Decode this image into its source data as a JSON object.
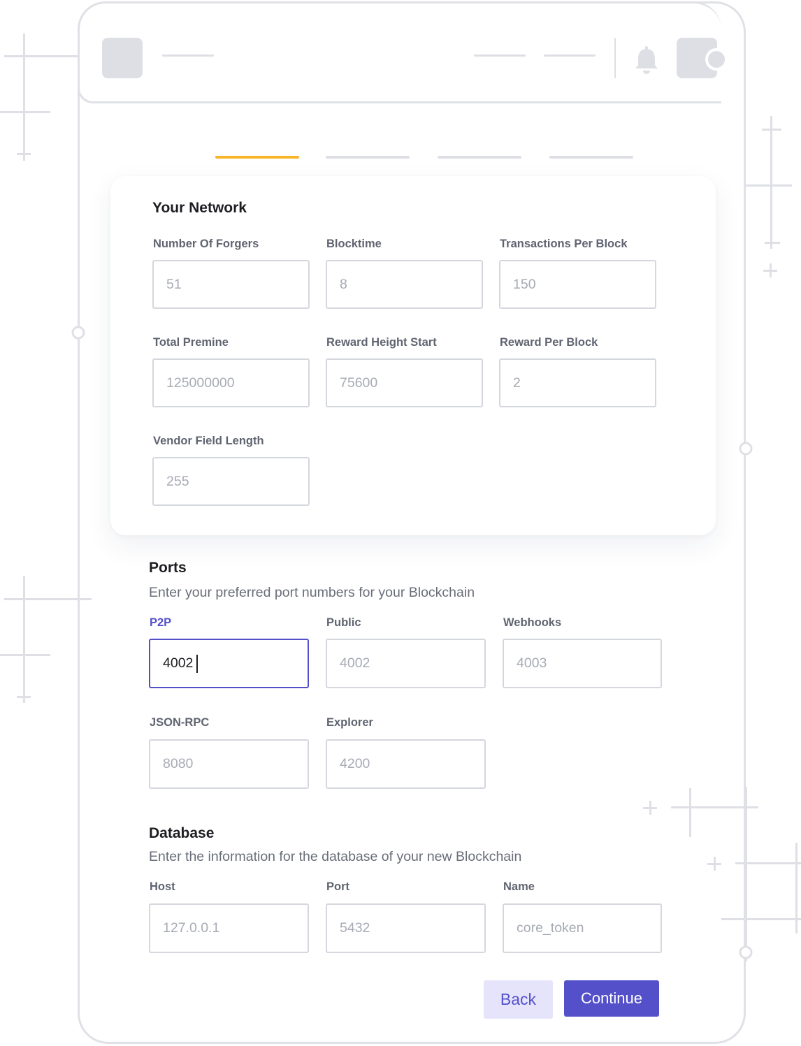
{
  "colors": {
    "accent": "#5450c9",
    "accent_soft": "#e5e4fb",
    "step_active": "#f7b52a",
    "placeholder_ui": "#dedfe5"
  },
  "header": {
    "notification_icon": "bell-icon"
  },
  "stepper": {
    "total_steps": 4,
    "active_step": 1
  },
  "network": {
    "title": "Your Network",
    "fields": [
      {
        "label": "Number Of Forgers",
        "placeholder": "51"
      },
      {
        "label": "Blocktime",
        "placeholder": "8"
      },
      {
        "label": "Transactions Per Block",
        "placeholder": "150"
      },
      {
        "label": "Total Premine",
        "placeholder": "125000000"
      },
      {
        "label": "Reward Height Start",
        "placeholder": "75600"
      },
      {
        "label": "Reward Per Block",
        "placeholder": "2"
      },
      {
        "label": "Vendor Field Length",
        "placeholder": "255"
      }
    ]
  },
  "ports": {
    "title": "Ports",
    "description": "Enter your preferred port numbers for your Blockchain",
    "fields": [
      {
        "label": "P2P",
        "value": "4002"
      },
      {
        "label": "Public",
        "placeholder": "4002"
      },
      {
        "label": "Webhooks",
        "placeholder": "4003"
      },
      {
        "label": "JSON-RPC",
        "placeholder": "8080"
      },
      {
        "label": "Explorer",
        "placeholder": "4200"
      }
    ]
  },
  "database": {
    "title": "Database",
    "description": "Enter the information for the database of your new Blockchain",
    "fields": [
      {
        "label": "Host",
        "placeholder": "127.0.0.1"
      },
      {
        "label": "Port",
        "placeholder": "5432"
      },
      {
        "label": "Name",
        "placeholder": "core_token"
      }
    ]
  },
  "actions": {
    "back_label": "Back",
    "continue_label": "Continue"
  }
}
